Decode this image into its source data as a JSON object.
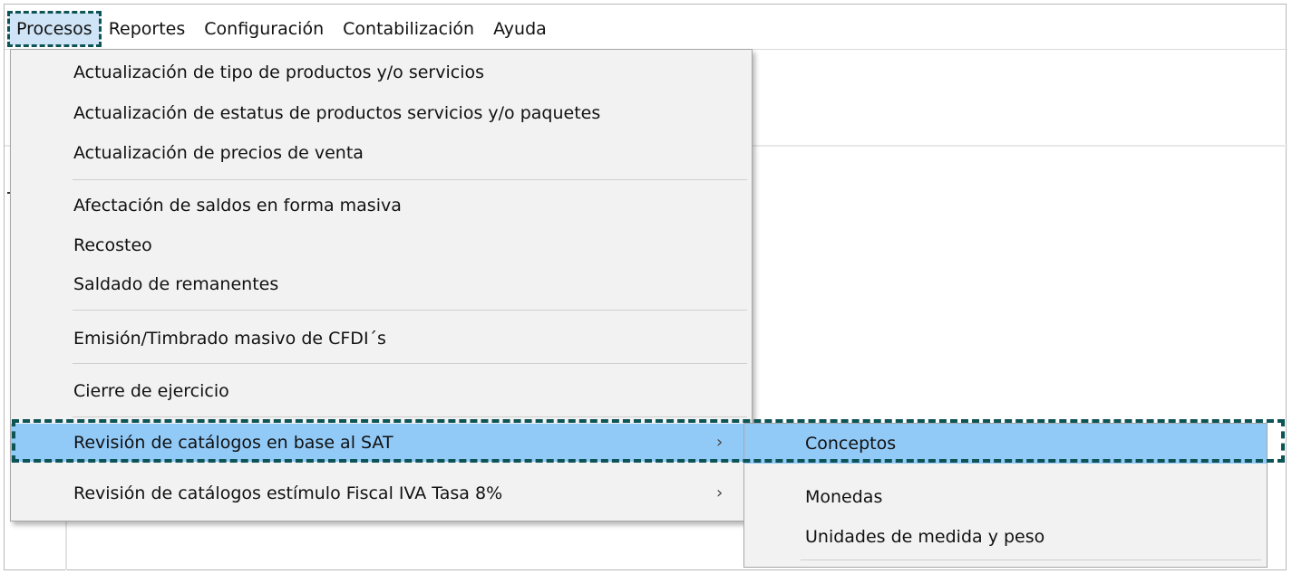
{
  "menubar": {
    "items": [
      {
        "label": "Procesos"
      },
      {
        "label": "Reportes"
      },
      {
        "label": "Configuración"
      },
      {
        "label": "Contabilización"
      },
      {
        "label": "Ayuda"
      }
    ]
  },
  "procesos_menu": {
    "items": [
      {
        "label": "Actualización de tipo de productos y/o servicios"
      },
      {
        "label": "Actualización de estatus de productos servicios y/o paquetes"
      },
      {
        "label": "Actualización de precios de venta"
      },
      {
        "label": "Afectación de saldos en forma masiva"
      },
      {
        "label": "Recosteo"
      },
      {
        "label": "Saldado de remanentes"
      },
      {
        "label": "Emisión/Timbrado masivo de CFDI´s"
      },
      {
        "label": "Cierre de ejercicio"
      },
      {
        "label": "Revisión de catálogos en base al SAT",
        "submenu_arrow": "›",
        "highlighted": true
      },
      {
        "label": "Revisión de catálogos estímulo Fiscal IVA Tasa 8%",
        "submenu_arrow": "›"
      }
    ]
  },
  "sat_submenu": {
    "items": [
      {
        "label": "Conceptos",
        "highlighted": true
      },
      {
        "label": "Monedas"
      },
      {
        "label": "Unidades de medida y peso"
      }
    ]
  },
  "colors": {
    "highlight": "#91c9f7",
    "focus_frame": "#0c5456",
    "menu_bg": "#f2f2f2"
  }
}
